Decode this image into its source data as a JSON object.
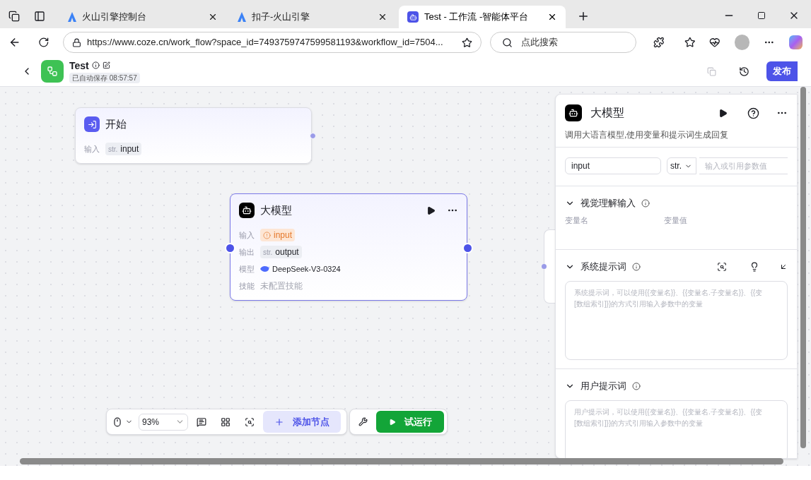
{
  "browser": {
    "tabs": [
      {
        "title": "火山引擎控制台",
        "selected": false
      },
      {
        "title": "扣子-火山引擎",
        "selected": false
      },
      {
        "title": "Test - 工作流 -智能体平台",
        "selected": true
      }
    ],
    "url": "https://www.coze.cn/work_flow?space_id=7493759747599581193&workflow_id=7504...",
    "search_placeholder": "点此搜索"
  },
  "header": {
    "title": "Test",
    "autosave": "已自动保存 08:57:57",
    "publish": "发布"
  },
  "nodes": [
    {
      "kind": "start",
      "title": "开始",
      "selected": false,
      "rows": [
        {
          "label": "输入",
          "kind": "param",
          "tag": "str.",
          "value": "input"
        }
      ]
    },
    {
      "kind": "llm",
      "title": "大模型",
      "selected": true,
      "rows": [
        {
          "label": "输入",
          "kind": "warning",
          "value": "input"
        },
        {
          "label": "输出",
          "kind": "param",
          "tag": "str.",
          "value": "output"
        },
        {
          "label": "模型",
          "kind": "model",
          "value": "DeepSeek-V3-0324"
        },
        {
          "label": "技能",
          "kind": "text",
          "value": "未配置技能"
        }
      ]
    }
  ],
  "panel": {
    "title": "大模型",
    "description": "调用大语言模型,使用变量和提示词生成回复",
    "input_row": {
      "name": "input",
      "type": "str.",
      "placeholder": "输入或引用参数值"
    },
    "sections": [
      {
        "kind": "columns",
        "title": "视觉理解输入",
        "expanded": true,
        "columns": [
          "变量名",
          "变量值"
        ]
      },
      {
        "kind": "prompt",
        "title": "系统提示词",
        "expanded": true,
        "tools": true,
        "lines": [
          "系统提示词，可以使用{{变量名}}、{{变量名.子变量名}}、{{变",
          "[数组索引]}}的方式引用输入参数中的变量"
        ]
      },
      {
        "kind": "prompt",
        "title": "用户提示词",
        "expanded": true,
        "tools": false,
        "lines": [
          "用户提示词，可以使用{{变量名}}、{{变量名.子变量名}}、{{变",
          "[数组索引]}}的方式引用输入参数中的变量"
        ]
      }
    ]
  },
  "toolbar": {
    "zoom": "93%",
    "add_node": "添加节点",
    "test_run": "试运行"
  }
}
